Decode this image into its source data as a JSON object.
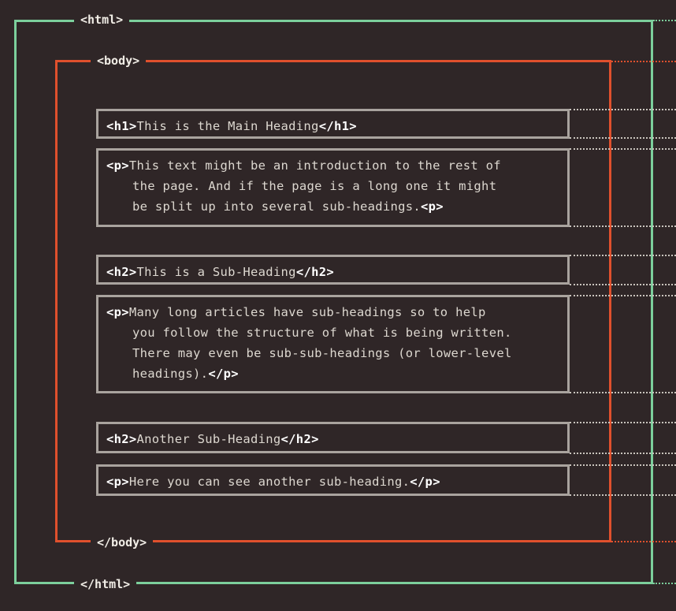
{
  "tags": {
    "html_open": "<html>",
    "html_close": "</html>",
    "body_open": "<body>",
    "body_close": "</body>"
  },
  "elements": [
    {
      "id": "h1",
      "open": "<h1>",
      "lines": [
        "This is the Main Heading"
      ],
      "close": "</h1>"
    },
    {
      "id": "p1",
      "open": "<p>",
      "lines": [
        "This text might be an introduction to the rest of",
        "the page. And if the page is a long one it might",
        "be split up into several sub-headings."
      ],
      "close": "<p>"
    },
    {
      "id": "h2a",
      "open": "<h2>",
      "lines": [
        "This is a Sub-Heading"
      ],
      "close": "</h2>"
    },
    {
      "id": "p2",
      "open": "<p>",
      "lines": [
        "Many long articles have sub-headings so to help",
        "you follow the structure of what is being written.",
        "There may even be sub-sub-headings (or lower-level",
        "headings)."
      ],
      "close": "</p>"
    },
    {
      "id": "h2b",
      "open": "<h2>",
      "lines": [
        "Another Sub-Heading"
      ],
      "close": "</h2>"
    },
    {
      "id": "p3",
      "open": "<p>",
      "lines": [
        "Here you can see another sub-heading."
      ],
      "close": "</p>"
    }
  ],
  "colors": {
    "background": "#2f2627",
    "html_frame": "#7ccf9c",
    "body_frame": "#e0502d",
    "element_box": "#a9a39e"
  }
}
